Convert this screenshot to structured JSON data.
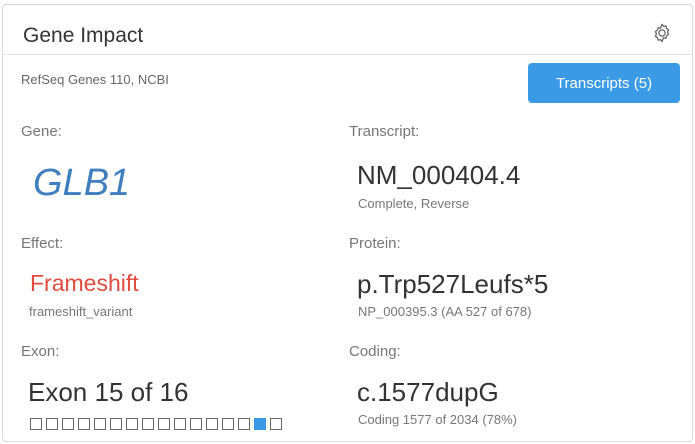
{
  "header": {
    "title": "Gene Impact",
    "settings_icon": "gear-icon"
  },
  "source": "RefSeq Genes 110, NCBI",
  "transcripts_button": "Transcripts (5)",
  "fields": {
    "gene_label": "Gene:",
    "gene_value": "GLB1",
    "transcript_label": "Transcript:",
    "transcript_value": "NM_000404.4",
    "transcript_sub": "Complete, Reverse",
    "effect_label": "Effect:",
    "effect_value": "Frameshift",
    "effect_sub": "frameshift_variant",
    "protein_label": "Protein:",
    "protein_value": "p.Trp527Leufs*5",
    "protein_sub": "NP_000395.3 (AA 527 of 678)",
    "exon_label": "Exon:",
    "exon_value": "Exon 15 of 16",
    "coding_label": "Coding:",
    "coding_value": "c.1577dupG",
    "coding_sub": "Coding 1577 of 2034 (78%)"
  },
  "exon_track": {
    "total": 16,
    "active": 15
  },
  "colors": {
    "accent": "#3b9ae6",
    "gene": "#3f7fbf",
    "effect": "#e04b3d"
  }
}
